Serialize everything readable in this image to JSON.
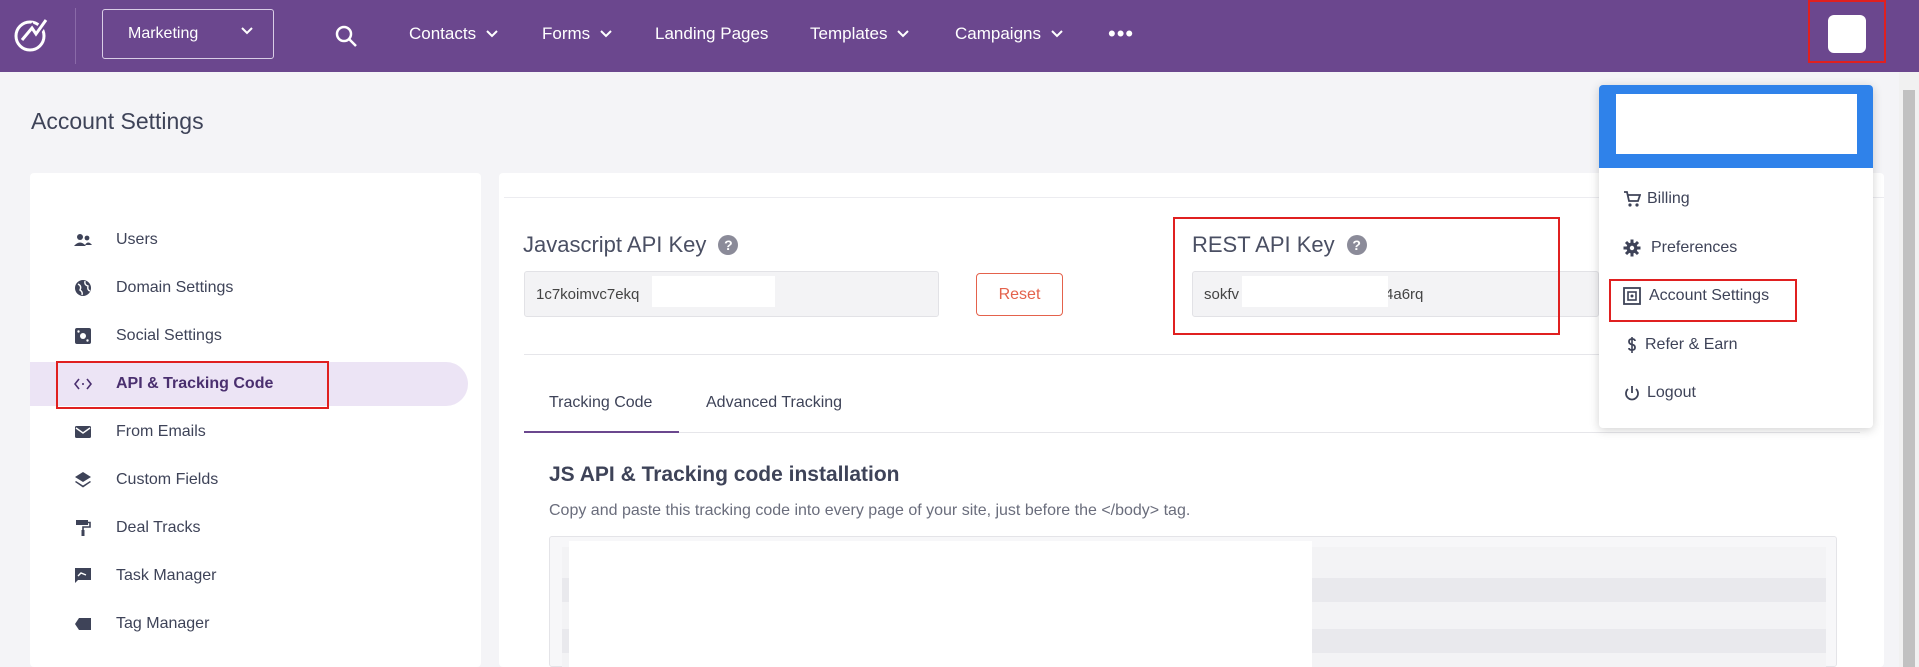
{
  "topbar": {
    "product_select": "Marketing",
    "nav": [
      "Contacts",
      "Forms",
      "Landing Pages",
      "Templates",
      "Campaigns"
    ],
    "more": "•••"
  },
  "page": {
    "title": "Account Settings"
  },
  "sidebar": {
    "items": [
      {
        "label": "Users",
        "icon": "users-icon"
      },
      {
        "label": "Domain Settings",
        "icon": "globe-icon"
      },
      {
        "label": "Social Settings",
        "icon": "social-icon"
      },
      {
        "label": "API & Tracking Code",
        "icon": "code-icon",
        "active": true
      },
      {
        "label": "From Emails",
        "icon": "mail-icon"
      },
      {
        "label": "Custom Fields",
        "icon": "layers-icon"
      },
      {
        "label": "Deal Tracks",
        "icon": "paint-roller-icon"
      },
      {
        "label": "Task Manager",
        "icon": "task-icon"
      },
      {
        "label": "Tag Manager",
        "icon": "tag-icon"
      }
    ]
  },
  "api": {
    "js_label": "Javascript API Key",
    "js_value": "1c7koimvc7ekq",
    "reset_label": "Reset",
    "rest_label": "REST API Key",
    "rest_prefix": "sokfv",
    "rest_suffix": "4a6rq"
  },
  "tabs": [
    "Tracking Code",
    "Advanced Tracking"
  ],
  "tracking": {
    "title": "JS API & Tracking code installation",
    "desc": "Copy and paste this tracking code into every page of your site, just before the </body> tag."
  },
  "menu": {
    "items": [
      {
        "label": "Billing",
        "icon": "cart-icon"
      },
      {
        "label": "Preferences",
        "icon": "gear-icon"
      },
      {
        "label": "Account Settings",
        "icon": "account-settings-icon"
      },
      {
        "label": "Refer & Earn",
        "icon": "dollar-icon"
      },
      {
        "label": "Logout",
        "icon": "power-icon"
      }
    ]
  },
  "colors": {
    "brand": "#6b478e",
    "menu_header": "#2f82ea",
    "highlight": "#e02020",
    "reset": "#e4624c"
  }
}
